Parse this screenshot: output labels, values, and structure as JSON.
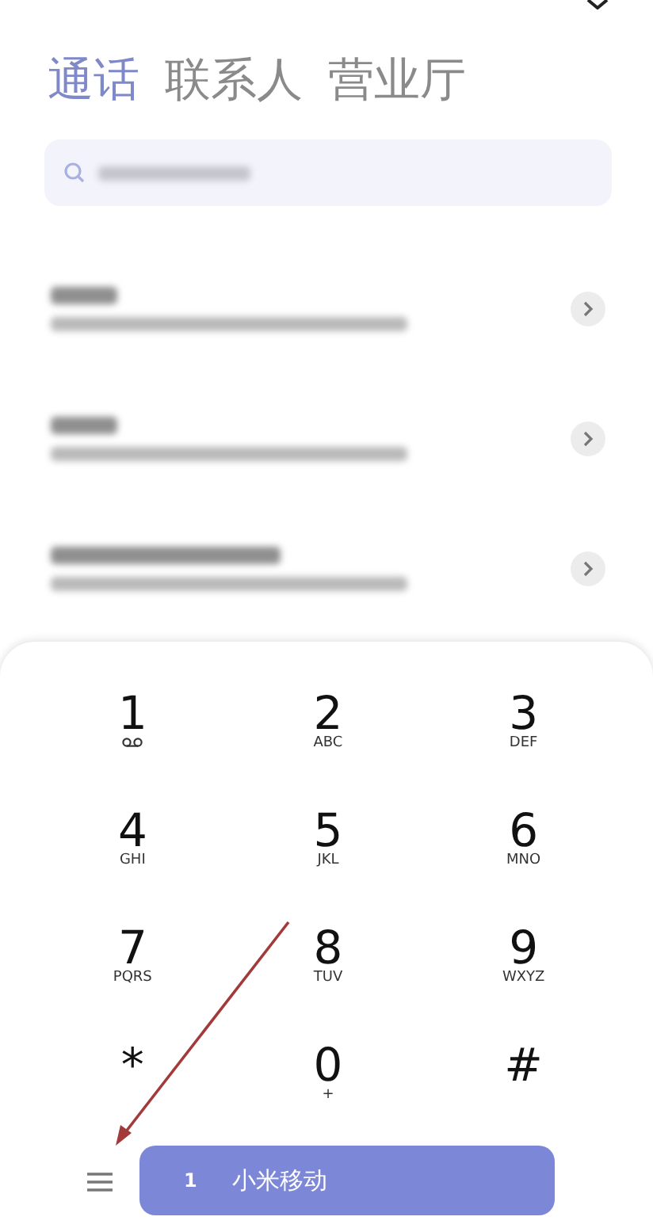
{
  "tabs": [
    {
      "label": "通话",
      "selected": true
    },
    {
      "label": "联系人",
      "selected": false
    },
    {
      "label": "营业厅",
      "selected": false
    }
  ],
  "search": {
    "kind": "blurred"
  },
  "call_log": [
    {
      "kind": "blurred"
    },
    {
      "kind": "blurred"
    },
    {
      "kind": "blurredlong"
    }
  ],
  "keypad": [
    {
      "digit": "1",
      "kind": "voicemail"
    },
    {
      "digit": "2",
      "kind": "letters",
      "letters": "ABC"
    },
    {
      "digit": "3",
      "kind": "letters",
      "letters": "DEF"
    },
    {
      "digit": "4",
      "kind": "letters",
      "letters": "GHI"
    },
    {
      "digit": "5",
      "kind": "letters",
      "letters": "JKL"
    },
    {
      "digit": "6",
      "kind": "letters",
      "letters": "MNO"
    },
    {
      "digit": "7",
      "kind": "letters",
      "letters": "PQRS"
    },
    {
      "digit": "8",
      "kind": "letters",
      "letters": "TUV"
    },
    {
      "digit": "9",
      "kind": "letters",
      "letters": "WXYZ"
    },
    {
      "digit": "*",
      "kind": "none"
    },
    {
      "digit": "0",
      "kind": "letters",
      "letters": "+"
    },
    {
      "digit": "#",
      "kind": "none"
    }
  ],
  "call_button": {
    "sim": "1",
    "label": "小米移动"
  }
}
